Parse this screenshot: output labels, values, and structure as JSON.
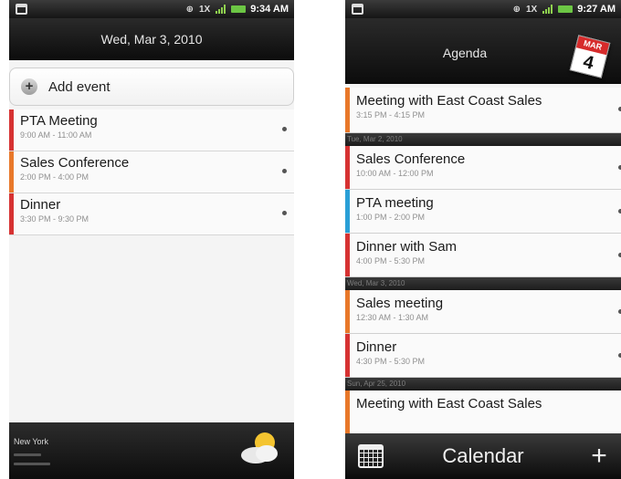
{
  "left": {
    "status_time": "9:34 AM",
    "date_title": "Wed, Mar 3, 2010",
    "add_event_label": "Add event",
    "events": [
      {
        "title": "PTA Meeting",
        "time": "9:00 AM - 11:00 AM",
        "color": "#d63232"
      },
      {
        "title": "Sales Conference",
        "time": "2:00 PM - 4:00 PM",
        "color": "#e8782a"
      },
      {
        "title": "Dinner",
        "time": "3:30 PM - 9:30 PM",
        "color": "#d63232"
      }
    ],
    "weather_city": "New York"
  },
  "right": {
    "status_time": "9:27 AM",
    "title": "Agenda",
    "calendar_badge": {
      "month": "MAR",
      "day": "4"
    },
    "first_item": {
      "title": "Meeting with East Coast Sales",
      "time": "3:15 PM - 4:15 PM",
      "color": "#e8782a"
    },
    "sep1": "Tue, Mar 2, 2010",
    "group1": [
      {
        "title": "Sales Conference",
        "time": "10:00 AM - 12:00 PM",
        "color": "#d63232"
      },
      {
        "title": "PTA meeting",
        "time": "1:00 PM - 2:00 PM",
        "color": "#2a9fd6"
      },
      {
        "title": "Dinner with Sam",
        "time": "4:00 PM - 5:30 PM",
        "color": "#d63232"
      }
    ],
    "sep2": "Wed, Mar 3, 2010",
    "group2": [
      {
        "title": "Sales meeting",
        "time": "12:30 AM - 1:30 AM",
        "color": "#e8782a"
      },
      {
        "title": "Dinner",
        "time": "4:30 PM - 5:30 PM",
        "color": "#d63232"
      }
    ],
    "sep3": "Sun, Apr 25, 2010",
    "last_item": {
      "title": "Meeting with East Coast Sales",
      "color": "#e8782a"
    },
    "bottom_label": "Calendar",
    "bottom_plus": "+"
  },
  "icons": {
    "gps": "gps-icon",
    "network": "network-1x-icon",
    "signal": "signal-icon",
    "battery": "battery-icon",
    "status_calendar": "calendar-notification-icon",
    "weather": "partly-cloudy-icon"
  }
}
